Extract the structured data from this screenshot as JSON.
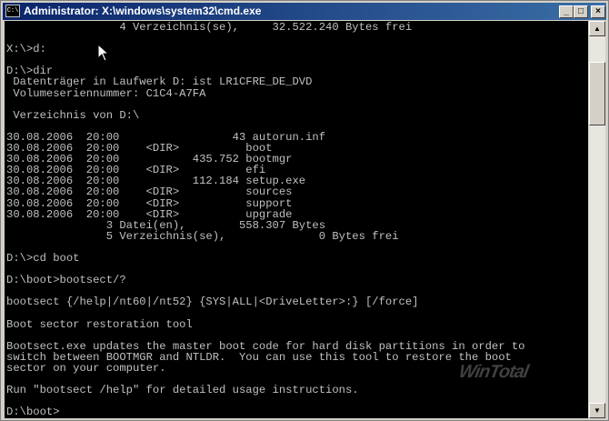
{
  "window": {
    "title": "Administrator: X:\\windows\\system32\\cmd.exe",
    "icon_text": "C:\\",
    "controls": {
      "minimize": "_",
      "maximize": "□",
      "close": "×"
    }
  },
  "console": {
    "text": "                 4 Verzeichnis(se),     32.522.240 Bytes frei\n\nX:\\>d:\n\nD:\\>dir\n Datenträger in Laufwerk D: ist LR1CFRE_DE_DVD\n Volumeseriennummer: C1C4-A7FA\n\n Verzeichnis von D:\\\n\n30.08.2006  20:00                 43 autorun.inf\n30.08.2006  20:00    <DIR>          boot\n30.08.2006  20:00           435.752 bootmgr\n30.08.2006  20:00    <DIR>          efi\n30.08.2006  20:00           112.184 setup.exe\n30.08.2006  20:00    <DIR>          sources\n30.08.2006  20:00    <DIR>          support\n30.08.2006  20:00    <DIR>          upgrade\n               3 Datei(en),        558.307 Bytes\n               5 Verzeichnis(se),              0 Bytes frei\n\nD:\\>cd boot\n\nD:\\boot>bootsect/?\n\nbootsect {/help|/nt60|/nt52} {SYS|ALL|<DriveLetter>:} [/force]\n\nBoot sector restoration tool\n\nBootsect.exe updates the master boot code for hard disk partitions in order to\nswitch between BOOTMGR and NTLDR.  You can use this tool to restore the boot\nsector on your computer.\n\nRun \"bootsect /help\" for detailed usage instructions.\n\nD:\\boot>",
    "watermark": "WinTotal"
  },
  "scrollbar": {
    "up_arrow": "▲",
    "down_arrow": "▼"
  },
  "colors": {
    "console_bg": "#000000",
    "console_fg": "#c0c0c0",
    "title_start": "#0a246a",
    "title_end": "#3a6ea5"
  }
}
